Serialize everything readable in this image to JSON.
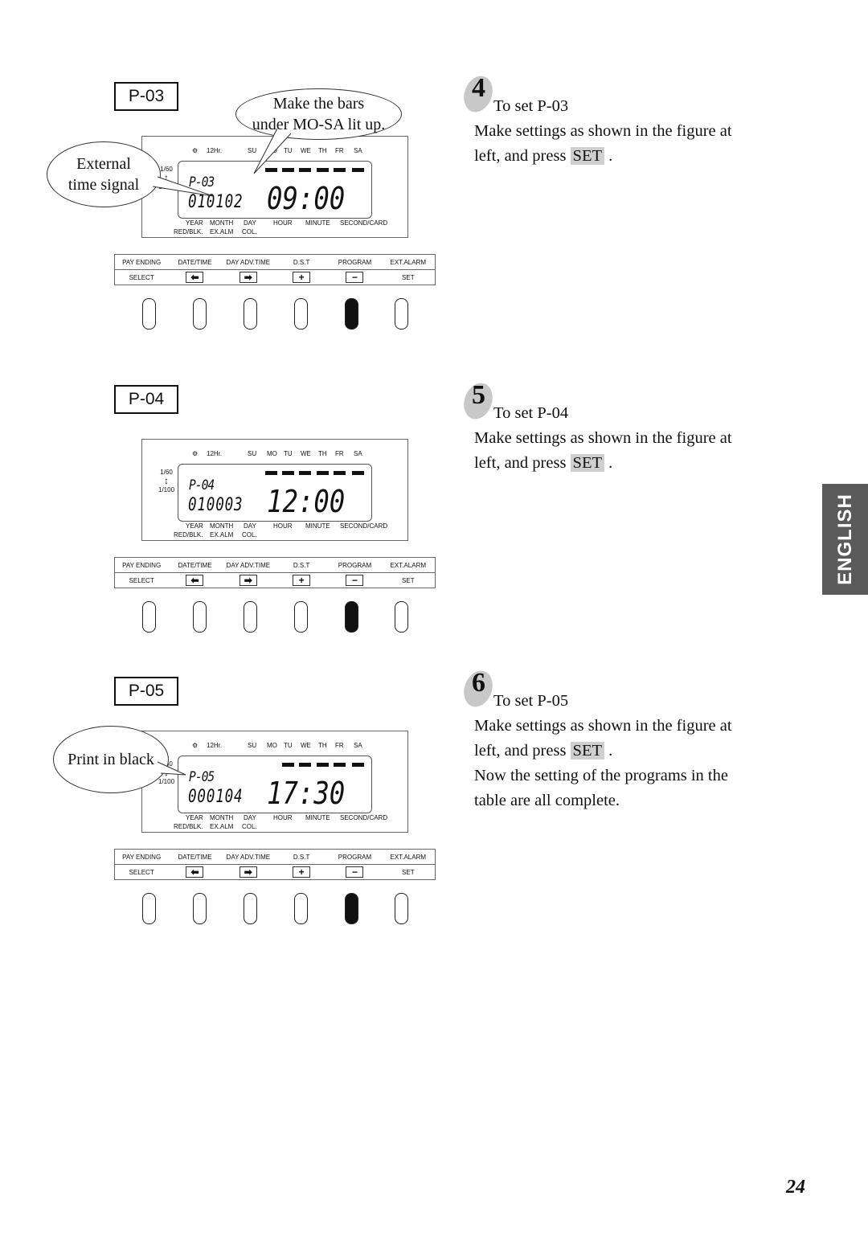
{
  "page_number": "24",
  "side_tab": "ENGLISH",
  "common_labels": {
    "top": [
      "12Hr.",
      "SU",
      "MO",
      "TU",
      "WE",
      "TH",
      "FR",
      "SA"
    ],
    "scale_top": "1/60",
    "scale_bottom": "1/100",
    "bottom_row1": [
      "YEAR",
      "MONTH",
      "DAY",
      "HOUR",
      "MINUTE",
      "SECOND/CARD"
    ],
    "bottom_row2": [
      "RED/BLK.",
      "EX.ALM",
      "COL."
    ],
    "buttons_row1": [
      "PAY ENDING",
      "DATE/TIME",
      "DAY ADV.TIME",
      "D.S.T",
      "PROGRAM",
      "EXT.ALARM"
    ],
    "buttons_row2": [
      "SELECT",
      "⬅",
      "➡",
      "+",
      "−",
      "SET"
    ]
  },
  "figures": [
    {
      "label": "P-03",
      "program": "P-03",
      "digits": "010102",
      "time": "09:00",
      "lit_days": [
        "MO",
        "TU",
        "WE",
        "TH",
        "FR",
        "SA"
      ],
      "active_key_index": 4,
      "callouts": [
        "Make the bars under MO-SA lit up.",
        "External time signal"
      ]
    },
    {
      "label": "P-04",
      "program": "P-04",
      "digits": "010003",
      "time": "12:00",
      "lit_days": [
        "MO",
        "TU",
        "WE",
        "TH",
        "FR",
        "SA"
      ],
      "active_key_index": 4,
      "callouts": []
    },
    {
      "label": "P-05",
      "program": "P-05",
      "digits": "000104",
      "time": "17:30",
      "lit_days": [
        "TU",
        "WE",
        "TH",
        "FR",
        "SA"
      ],
      "active_key_index": 4,
      "callouts": [
        "Print in black"
      ]
    }
  ],
  "callouts": {
    "bars_line1": "Make the bars",
    "bars_line2": "under MO-SA lit up.",
    "ext_line1": "External",
    "ext_line2": "time signal",
    "black": "Print in black"
  },
  "steps": [
    {
      "number": "4",
      "title": "To set P-03",
      "line1": "Make settings as shown in the figure at",
      "line2_pre": "left, and press",
      "key": "SET",
      "line2_post": ".",
      "extra": []
    },
    {
      "number": "5",
      "title": "To set P-04",
      "line1": "Make settings as shown in the figure at",
      "line2_pre": "left, and press",
      "key": "SET",
      "line2_post": ".",
      "extra": []
    },
    {
      "number": "6",
      "title": "To set P-05",
      "line1": "Make settings as shown in the figure at",
      "line2_pre": "left, and press",
      "key": "SET",
      "line2_post": ".",
      "extra": [
        "Now the setting of the programs in the",
        "table are all complete."
      ]
    }
  ]
}
